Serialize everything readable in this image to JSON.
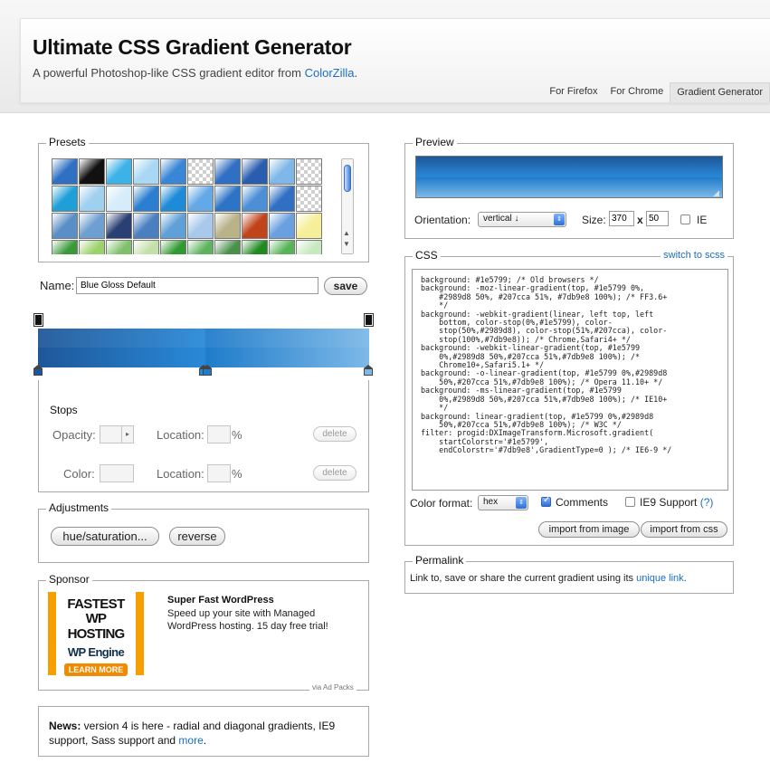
{
  "header": {
    "title": "Ultimate CSS Gradient Generator",
    "subtitle_prefix": "A powerful Photoshop-like CSS gradient editor from ",
    "subtitle_link": "ColorZilla",
    "subtitle_suffix": ".",
    "nav": [
      "For Firefox",
      "For Chrome",
      "Gradient Generator"
    ],
    "active_nav": "Gradient Generator"
  },
  "presets": {
    "legend": "Presets",
    "swatch_colors": [
      "#2f6fc4",
      "#111111",
      "#3db2e8",
      "#a9d8f5",
      "#3a86d6",
      "#a8c4e6",
      "#2f6fc4",
      "#2a5db0",
      "#7fb8e8",
      "#e8e8e8",
      "#1f9fd8",
      "#9fd0f0",
      "#d6ecfa",
      "#2a7fd0",
      "#1e8bd8",
      "#63a9e8",
      "#2d74c6",
      "#4d8fd6",
      "#2f6fc4",
      "#ffffff",
      "#5a8ec6",
      "#6e9fd0",
      "#2a3f73",
      "#4a7fc0",
      "#5fa0d8",
      "#a8c9ec",
      "#b9b38a",
      "#c0431a",
      "#6aa0e0",
      "#f6ef9a",
      "#3a9a3a",
      "#9bd26b",
      "#7fc06a",
      "#c2e0a8",
      "#2f9a2f",
      "#5db35d",
      "#4a8f4a",
      "#1f8a1f",
      "#56b456",
      "#c8e8c0"
    ]
  },
  "name": {
    "label": "Name:",
    "value": "Blue Gloss Default",
    "save_button": "save"
  },
  "gradient": {
    "stops": [
      {
        "color": "#1e5799",
        "position": 0
      },
      {
        "color": "#2989d8",
        "position": 50
      },
      {
        "color": "#207cca",
        "position": 51
      },
      {
        "color": "#7db9e8",
        "position": 100
      }
    ]
  },
  "stops": {
    "legend": "Stops",
    "opacity_label": "Opacity:",
    "location_label": "Location:",
    "percent": "%",
    "color_label": "Color:",
    "delete_label": "delete"
  },
  "adjustments": {
    "legend": "Adjustments",
    "hue_button": "hue/saturation...",
    "reverse_button": "reverse"
  },
  "sponsor": {
    "legend": "Sponsor",
    "ad_line1": "FASTEST",
    "ad_line2": "WP HOSTING",
    "ad_line3": "WP Engine",
    "ad_button": "LEARN MORE",
    "headline": "Super Fast WordPress",
    "body": "Speed up your site with Managed WordPress hosting. 15 day free trial!",
    "via": "via Ad Packs"
  },
  "news": {
    "label": "News:",
    "text": " version 4 is here - radial and diagonal gradients, IE9 support, Sass support and ",
    "link": "more",
    "suffix": "."
  },
  "preview": {
    "legend": "Preview",
    "orientation_label": "Orientation:",
    "orientation_value": "vertical ↓",
    "size_label": "Size:",
    "width": "370",
    "x": "x",
    "height": "50",
    "ie_label": "IE"
  },
  "css": {
    "legend": "CSS",
    "switch_link": "switch to scss",
    "code": "background: #1e5799; /* Old browsers */\nbackground: -moz-linear-gradient(top, #1e5799 0%,\n    #2989d8 50%, #207cca 51%, #7db9e8 100%); /* FF3.6+\n    */\nbackground: -webkit-gradient(linear, left top, left\n    bottom, color-stop(0%,#1e5799), color-\n    stop(50%,#2989d8), color-stop(51%,#207cca), color-\n    stop(100%,#7db9e8)); /* Chrome,Safari4+ */\nbackground: -webkit-linear-gradient(top, #1e5799\n    0%,#2989d8 50%,#207cca 51%,#7db9e8 100%); /*\n    Chrome10+,Safari5.1+ */\nbackground: -o-linear-gradient(top, #1e5799 0%,#2989d8\n    50%,#207cca 51%,#7db9e8 100%); /* Opera 11.10+ */\nbackground: -ms-linear-gradient(top, #1e5799\n    0%,#2989d8 50%,#207cca 51%,#7db9e8 100%); /* IE10+\n    */\nbackground: linear-gradient(top, #1e5799 0%,#2989d8\n    50%,#207cca 51%,#7db9e8 100%); /* W3C */\nfilter: progid:DXImageTransform.Microsoft.gradient(\n    startColorstr='#1e5799',\n    endColorstr='#7db9e8',GradientType=0 ); /* IE6-9 */",
    "color_format_label": "Color format:",
    "color_format_value": "hex",
    "comments_label": "Comments",
    "ie9_label": "IE9 Support",
    "ie9_help": "(?)",
    "import_image": "import from image",
    "import_css": "import from css"
  },
  "permalink": {
    "legend": "Permalink",
    "text": "Link to, save or share the current gradient using its ",
    "link": "unique link",
    "suffix": "."
  }
}
